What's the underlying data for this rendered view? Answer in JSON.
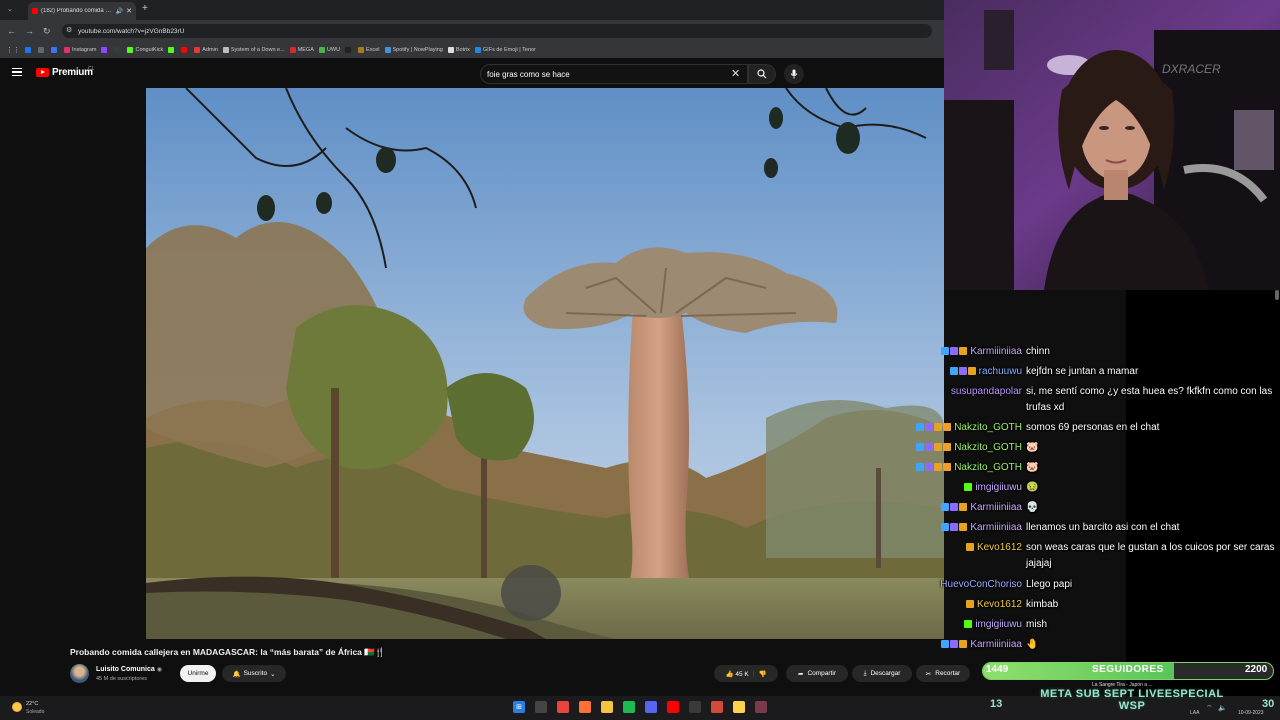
{
  "browser": {
    "tab_title": "(182) Probando comida cal",
    "url": "youtube.com/watch?v=jzVGnBb23rU",
    "bookmarks": [
      {
        "label": "",
        "color": "#1877f2"
      },
      {
        "label": "",
        "color": "#666666"
      },
      {
        "label": "",
        "color": "#3a76f0"
      },
      {
        "label": "Instagram",
        "color": "#e1306c"
      },
      {
        "label": "",
        "color": "#9146ff"
      },
      {
        "label": "",
        "color": "#3a3a3a"
      },
      {
        "label": "ConguiKick",
        "color": "#53fc18"
      },
      {
        "label": "",
        "color": "#53fc18"
      },
      {
        "label": "",
        "color": "#ff0000"
      },
      {
        "label": "Admin",
        "color": "#e03a3a"
      },
      {
        "label": "System of a Down e...",
        "color": "#bbbbbb"
      },
      {
        "label": "MEGA",
        "color": "#d9272e"
      },
      {
        "label": "UWU",
        "color": "#4caf50"
      },
      {
        "label": "",
        "color": "#222222"
      },
      {
        "label": "Excel",
        "color": "#a57c1b"
      },
      {
        "label": "Spotify | NowPlaying",
        "color": "#4a90e2"
      },
      {
        "label": "Botrix",
        "color": "#dddddd"
      },
      {
        "label": "GIFs de Emoji | Tenor",
        "color": "#1e88e5"
      }
    ]
  },
  "youtube": {
    "logo_text": "Premium",
    "logo_sup": "CL",
    "search_query": "foie gras como se hace",
    "video_title": "Probando comida callejera en MADAGASCAR: la “más barata” de África 🇲🇬🍴",
    "channel_name": "Luisito Comunica",
    "subscribers": "45 M de suscriptores",
    "join_label": "Unirme",
    "subscribed_label": "Suscrito",
    "like_count": "45 K",
    "share_label": "Compartir",
    "download_label": "Descargar",
    "clip_label": "Recortar"
  },
  "chat": [
    {
      "user": "Karmiiiniiaa",
      "color": "#c8a4ff",
      "msg": "chinn",
      "badges": [
        "#3ea6ff",
        "#8c6cff",
        "#e6a31e"
      ]
    },
    {
      "user": "rachuuwu",
      "color": "#7fb2ff",
      "msg": "kejfdn se juntan a mamar",
      "badges": [
        "#3ea6ff",
        "#8c6cff",
        "#e6a31e"
      ]
    },
    {
      "user": "susupandapolar",
      "color": "#b995ff",
      "msg": "si, me sentí como ¿y esta huea es? fkfkfn como con las trufas xd",
      "badges": []
    },
    {
      "user": "Nakzito_GOTH",
      "color": "#9cf26a",
      "msg": "somos 69 personas en el chat",
      "badges": [
        "#3ea6ff",
        "#8c6cff",
        "#e6a31e",
        "#f0a02a"
      ]
    },
    {
      "user": "Nakzito_GOTH",
      "color": "#9cf26a",
      "msg": "🐷",
      "badges": [
        "#3ea6ff",
        "#8c6cff",
        "#e6a31e",
        "#f0a02a"
      ]
    },
    {
      "user": "Nakzito_GOTH",
      "color": "#9cf26a",
      "msg": "🐷",
      "badges": [
        "#3ea6ff",
        "#8c6cff",
        "#e6a31e",
        "#f0a02a"
      ]
    },
    {
      "user": "imgigiiuwu",
      "color": "#c6a8ff",
      "msg": "🤢",
      "badges": [
        "#53fc18"
      ]
    },
    {
      "user": "Karmiiiniiaa",
      "color": "#c8a4ff",
      "msg": "💀",
      "badges": [
        "#3ea6ff",
        "#8c6cff",
        "#e6a31e"
      ]
    },
    {
      "user": "Karmiiiniiaa",
      "color": "#c8a4ff",
      "msg": "llenamos un barcito asi con el chat",
      "badges": [
        "#3ea6ff",
        "#8c6cff",
        "#e6a31e"
      ]
    },
    {
      "user": "Kevo1612",
      "color": "#f0c93a",
      "msg": "son weas caras que le gustan a los cuicos por ser caras jajajaj",
      "badges": [
        "#e6a31e"
      ]
    },
    {
      "user": "HuevoConChoriso",
      "color": "#9aa8ff",
      "msg": "Llego papi",
      "badges": []
    },
    {
      "user": "Kevo1612",
      "color": "#f0c93a",
      "msg": "kimbab",
      "badges": [
        "#e6a31e"
      ]
    },
    {
      "user": "imgigiiuwu",
      "color": "#c6a8ff",
      "msg": "mish",
      "badges": [
        "#53fc18"
      ]
    },
    {
      "user": "Karmiiiniiaa",
      "color": "#c8a4ff",
      "msg": "🤚",
      "badges": [
        "#3ea6ff",
        "#8c6cff",
        "#e6a31e"
      ]
    }
  ],
  "followers": {
    "current": "1449",
    "label": "SEGUIDORES",
    "goal": "2200",
    "progress": 0.66
  },
  "meta_banner": {
    "line1": "META SUB SEPT LIVEESPECIAL",
    "line2": "WSP",
    "left_num": "13",
    "right_num": "30",
    "sub_text": "La Sangre Tira - Japón a ..."
  },
  "taskbar": {
    "temp": "22°C",
    "weather": "Soleado",
    "date": "10-09-2023",
    "tray_lang": "LAA",
    "apps": [
      {
        "name": "windows-start-icon",
        "color": "#2a7de1",
        "glyph": "⊞"
      },
      {
        "name": "search-app-icon",
        "color": "#444444",
        "glyph": ""
      },
      {
        "name": "chrome-icon",
        "color": "#e8453c",
        "glyph": ""
      },
      {
        "name": "firefox-icon",
        "color": "#ff7139",
        "glyph": ""
      },
      {
        "name": "file-explorer-icon",
        "color": "#f5c342",
        "glyph": ""
      },
      {
        "name": "spotify-icon",
        "color": "#1db954",
        "glyph": ""
      },
      {
        "name": "discord-icon",
        "color": "#5865f2",
        "glyph": ""
      },
      {
        "name": "youtube-app-icon",
        "color": "#ff0000",
        "glyph": ""
      },
      {
        "name": "obs-icon",
        "color": "#3a3a3a",
        "glyph": ""
      },
      {
        "name": "chrome-alt-icon",
        "color": "#d24a3a",
        "glyph": ""
      },
      {
        "name": "notes-app-icon",
        "color": "#fbd34d",
        "glyph": ""
      },
      {
        "name": "active-app-icon",
        "color": "#7a3a4a",
        "glyph": ""
      }
    ]
  }
}
